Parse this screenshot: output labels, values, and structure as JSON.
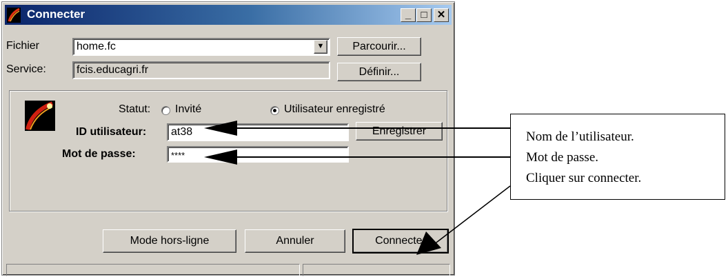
{
  "window": {
    "title": "Connecter",
    "controls": {
      "minimize": "_",
      "maximize": "□",
      "close": "✕"
    }
  },
  "file_row": {
    "label": "Fichier",
    "value": "home.fc",
    "browse_button": "Parcourir..."
  },
  "service_row": {
    "label": "Service:",
    "value": "fcis.educagri.fr",
    "define_button": "Définir..."
  },
  "status": {
    "label": "Statut:",
    "options": [
      {
        "label": "Invité",
        "selected": false
      },
      {
        "label": "Utilisateur enregistré",
        "selected": true
      }
    ]
  },
  "user_id": {
    "label": "ID utilisateur:",
    "value": "at38",
    "register_button": "Enregistrer"
  },
  "password": {
    "label": "Mot de passe:",
    "value": "****"
  },
  "buttons": {
    "offline": "Mode hors-ligne",
    "cancel": "Annuler",
    "connect": "Connecter"
  },
  "annotation": {
    "lines": [
      "Nom de l’utilisateur.",
      "Mot de passe.",
      "Cliquer sur connecter."
    ]
  },
  "colors": {
    "titlebar_start": "#0a246a",
    "titlebar_end": "#a6caf0",
    "dialog_bg": "#d4d0c8"
  }
}
